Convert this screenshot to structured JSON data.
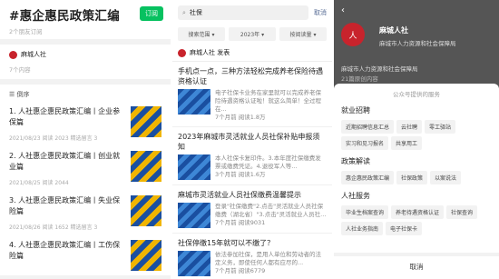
{
  "p1": {
    "title": "#惠企惠民政策汇编",
    "subscribe": "订阅",
    "sub_count": "2个朋友订阅",
    "account": "麻城人社",
    "count": "7个内容",
    "sort": "倒序",
    "items": [
      {
        "title": "1. 人社惠企惠民政策汇编丨企业参保篇",
        "meta": "2021/08/23  阅读 2023  精选留言 3"
      },
      {
        "title": "2. 人社惠企惠民政策汇编丨创业就业篇",
        "meta": "2021/08/25  阅读 2044"
      },
      {
        "title": "3. 人社惠企惠民政策汇编丨失业保险篇",
        "meta": "2021/08/26  阅读 1652  精选留言 3"
      },
      {
        "title": "4. 人社惠企惠民政策汇编丨工伤保险篇",
        "meta": ""
      }
    ]
  },
  "p2": {
    "query": "社保",
    "cancel": "取消",
    "filters": [
      "搜索范围",
      "2023年",
      "按阅读量"
    ],
    "source": "麻城人社 发表",
    "articles": [
      {
        "title": "手机点一点，三种方法轻松完成养老保险待遇资格认证",
        "excerpt": "电子社保卡业务在家里就可以完成养老保险待遇资格认证啦！就这么简单！全过程在...",
        "meta": "7个月前  阅读1.8万"
      },
      {
        "title": "2023年麻城市灵活就业人员社保补贴申报须知",
        "excerpt": "本人社保卡复印件。3.本年度社保缴费发票或缴费凭证。4.退役军人等...",
        "meta": "3个月前  阅读1.6万"
      },
      {
        "title": "麻城市灵活就业人员社保缴费温馨提示",
        "excerpt": "登录\"社保缴费\"2.点击\"灵活就业人员社保缴费（湖北省）\"3.点击\"灵活就业人员社...",
        "meta": "7个月前  阅读9031"
      },
      {
        "title": "社保停缴15年就可以不缴了？",
        "excerpt": "依法参加社保，是用人单位和劳动者的法定义务，即使任何人都有应尽的...",
        "meta": "7个月前  阅读6779"
      }
    ]
  },
  "p3": {
    "name": "麻城人社",
    "desc": "麻城市人力资源和社会保障局",
    "sub": "麻城市人力资源和社会保障局",
    "sub2": "21篇原创内容",
    "sheet_title": "公众号提供的服务",
    "sections": [
      {
        "name": "就业招聘",
        "chips": [
          "近期招聘信息汇总",
          "云社聘",
          "零工驿站",
          "实习和见习报名",
          "共享用工"
        ]
      },
      {
        "name": "政策解读",
        "chips": [
          "惠企惠民政策汇编",
          "社保政策",
          "以案说法"
        ]
      },
      {
        "name": "人社服务",
        "chips": [
          "毕业生档案查询",
          "养老待遇资格认证",
          "社保查询",
          "人社业务指南",
          "电子社保卡"
        ]
      }
    ],
    "cancel": "取消"
  }
}
